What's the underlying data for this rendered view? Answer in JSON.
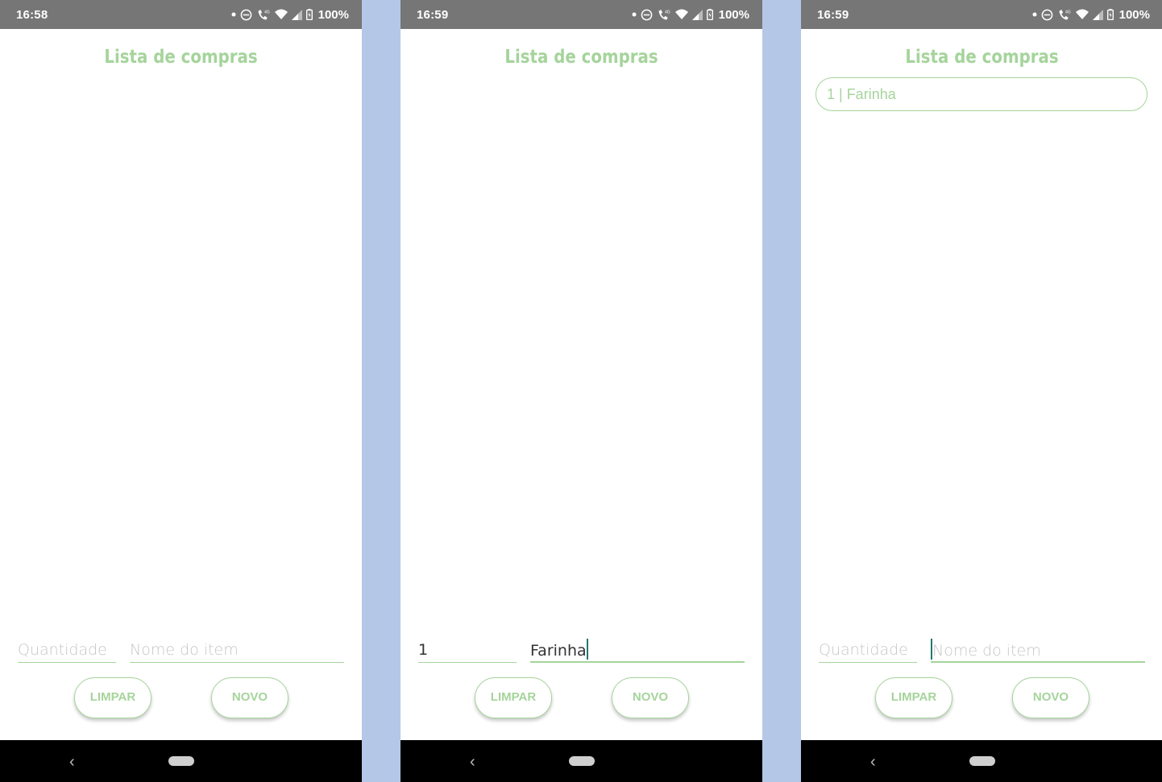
{
  "colors": {
    "accent": "#a5d49b",
    "status_bar": "#767676",
    "nav_bar": "#000000",
    "background": "#b4c7e7",
    "cursor": "#1f7a72"
  },
  "screens": [
    {
      "status": {
        "time": "16:58",
        "battery": "100%"
      },
      "title": "Lista de compras",
      "list": [],
      "quantity": {
        "value": "",
        "placeholder": "Quantidade"
      },
      "item_name": {
        "value": "",
        "placeholder": "Nome do item"
      },
      "buttons": {
        "clear": "LIMPAR",
        "new": "NOVO"
      }
    },
    {
      "status": {
        "time": "16:59",
        "battery": "100%"
      },
      "title": "Lista de compras",
      "list": [],
      "quantity": {
        "value": "1",
        "placeholder": "Quantidade"
      },
      "item_name": {
        "value": "Farinha",
        "placeholder": "Nome do item"
      },
      "buttons": {
        "clear": "LIMPAR",
        "new": "NOVO"
      }
    },
    {
      "status": {
        "time": "16:59",
        "battery": "100%"
      },
      "title": "Lista de compras",
      "list": [
        "1 | Farinha"
      ],
      "quantity": {
        "value": "",
        "placeholder": "Quantidade"
      },
      "item_name": {
        "value": "",
        "placeholder": "Nome do item"
      },
      "buttons": {
        "clear": "LIMPAR",
        "new": "NOVO"
      }
    }
  ]
}
